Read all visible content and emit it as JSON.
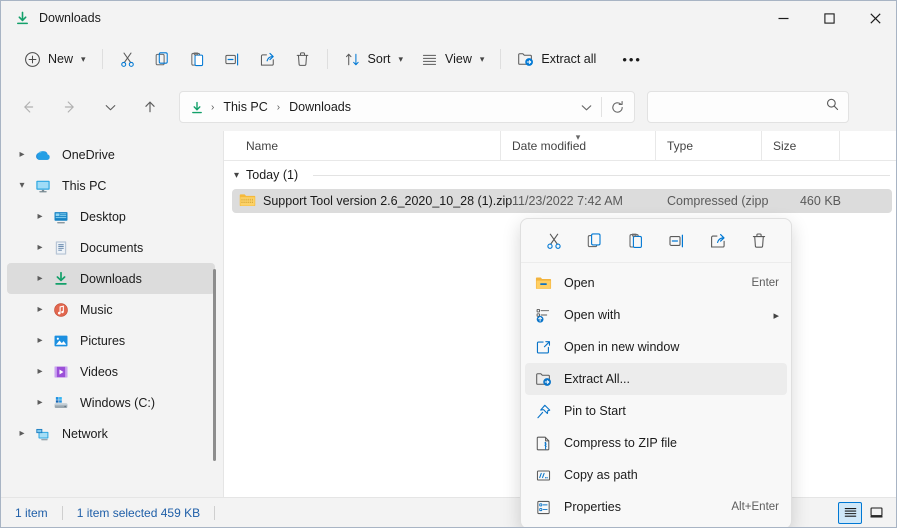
{
  "window": {
    "title": "Downloads",
    "title_icon": "downloads-arrow-icon",
    "controls": {
      "minimize": "Minimize",
      "maximize": "Maximize",
      "close": "Close"
    }
  },
  "toolbar": {
    "new_label": "New",
    "cut_label": "Cut",
    "copy_label": "Copy",
    "paste_label": "Paste",
    "rename_label": "Rename",
    "share_label": "Share",
    "delete_label": "Delete",
    "sort_label": "Sort",
    "view_label": "View",
    "extract_all_label": "Extract all",
    "more_label": "See more"
  },
  "navigation": {
    "back_label": "Back",
    "forward_label": "Forward",
    "recent_label": "Recent locations",
    "up_label": "Up to This PC",
    "refresh_label": "Refresh",
    "previous_locations_label": "Previous locations",
    "breadcrumb": [
      "This PC",
      "Downloads"
    ],
    "breadcrumb_separator": "›"
  },
  "search": {
    "value": "",
    "placeholder": ""
  },
  "sidebar": {
    "items": [
      {
        "label": "OneDrive",
        "icon": "onedrive-cloud-icon",
        "level": 1,
        "expander": "collapsed",
        "selected": false
      },
      {
        "label": "This PC",
        "icon": "this-pc-monitor-icon",
        "level": 1,
        "expander": "expanded",
        "selected": false
      },
      {
        "label": "Desktop",
        "icon": "desktop-icon",
        "level": 2,
        "expander": "collapsed",
        "selected": false
      },
      {
        "label": "Documents",
        "icon": "documents-icon",
        "level": 2,
        "expander": "collapsed",
        "selected": false
      },
      {
        "label": "Downloads",
        "icon": "downloads-arrow-icon",
        "level": 2,
        "expander": "collapsed",
        "selected": true
      },
      {
        "label": "Music",
        "icon": "music-note-icon",
        "level": 2,
        "expander": "collapsed",
        "selected": false
      },
      {
        "label": "Pictures",
        "icon": "pictures-icon",
        "level": 2,
        "expander": "collapsed",
        "selected": false
      },
      {
        "label": "Videos",
        "icon": "videos-icon",
        "level": 2,
        "expander": "collapsed",
        "selected": false
      },
      {
        "label": "Windows (C:)",
        "icon": "hard-drive-icon",
        "level": 2,
        "expander": "collapsed",
        "selected": false
      },
      {
        "label": "Network",
        "icon": "network-icon",
        "level": 1,
        "expander": "collapsed",
        "selected": false
      }
    ]
  },
  "file_list": {
    "columns": [
      {
        "label": "Name",
        "sorted": false
      },
      {
        "label": "Date modified",
        "sorted": true
      },
      {
        "label": "Type",
        "sorted": false
      },
      {
        "label": "Size",
        "sorted": false
      }
    ],
    "group": {
      "label": "Today (1)",
      "expanded": true
    },
    "rows": [
      {
        "name": "Support Tool version 2.6_2020_10_28 (1).zip",
        "date_modified": "11/23/2022 7:42 AM",
        "type": "Compressed (zipp",
        "size": "460 KB",
        "icon": "zip-folder-icon",
        "selected": true
      }
    ]
  },
  "context_menu": {
    "tools": [
      {
        "name": "cut-icon",
        "label": "Cut"
      },
      {
        "name": "copy-icon",
        "label": "Copy"
      },
      {
        "name": "paste-icon",
        "label": "Paste"
      },
      {
        "name": "rename-icon",
        "label": "Rename"
      },
      {
        "name": "share-icon",
        "label": "Share"
      },
      {
        "name": "delete-icon",
        "label": "Delete"
      }
    ],
    "items": [
      {
        "label": "Open",
        "accel": "Enter",
        "icon": "folder-open-icon",
        "submenu": false,
        "highlight": false
      },
      {
        "label": "Open with",
        "accel": "",
        "icon": "open-with-icon",
        "submenu": true,
        "highlight": false
      },
      {
        "label": "Open in new window",
        "accel": "",
        "icon": "new-window-icon",
        "submenu": false,
        "highlight": false
      },
      {
        "label": "Extract All...",
        "accel": "",
        "icon": "extract-all-icon",
        "submenu": false,
        "highlight": true
      },
      {
        "label": "Pin to Start",
        "accel": "",
        "icon": "pin-icon",
        "submenu": false,
        "highlight": false
      },
      {
        "label": "Compress to ZIP file",
        "accel": "",
        "icon": "compress-zip-icon",
        "submenu": false,
        "highlight": false
      },
      {
        "label": "Copy as path",
        "accel": "",
        "icon": "copy-as-path-icon",
        "submenu": false,
        "highlight": false
      },
      {
        "label": "Properties",
        "accel": "Alt+Enter",
        "icon": "properties-icon",
        "submenu": false,
        "highlight": false
      }
    ]
  },
  "status_bar": {
    "item_count": "1 item",
    "selection": "1 item selected  459 KB",
    "view_details_label": "Details view",
    "view_large_icons_label": "Large icons view"
  },
  "colors": {
    "accent": "#0078d4",
    "status_text": "#1f5fa8",
    "selection": "#dcdcdc",
    "window_bg": "#f3f3f3",
    "list_bg": "#ffffff",
    "zip_yellow": "#f5b93a"
  }
}
